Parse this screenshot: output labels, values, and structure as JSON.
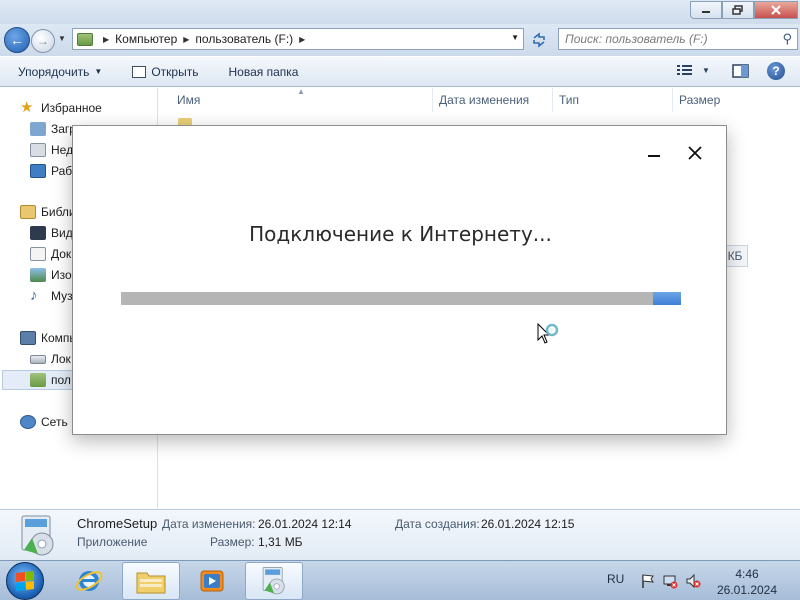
{
  "explorer": {
    "address": {
      "crumbs": [
        "Компьютер",
        "пользователь (F:)"
      ]
    },
    "search": {
      "placeholder": "Поиск: пользователь (F:)"
    },
    "toolbar": {
      "organize": "Упорядочить",
      "open": "Открыть",
      "new_folder": "Новая папка"
    },
    "nav": {
      "favorites": "Избранное",
      "fav_downloads": "Загр",
      "fav_recent": "Нед",
      "fav_desktop": "Раб",
      "libraries": "Библи",
      "lib_video": "Вид",
      "lib_docs": "Док",
      "lib_images": "Изо",
      "lib_music": "Муз",
      "computer": "Компь",
      "local_disk": "Лок",
      "user_drive": "пол",
      "network": "Сеть"
    },
    "columns": [
      "Имя",
      "Дата изменения",
      "Тип",
      "Размер"
    ],
    "peek_size_unit": "КБ",
    "details": {
      "name": "ChromeSetup",
      "type": "Приложение",
      "modified_label": "Дата изменения:",
      "modified_value": "26.01.2024 12:14",
      "size_label": "Размер:",
      "size_value": "1,31 МБ",
      "created_label": "Дата создания:",
      "created_value": "26.01.2024 12:15"
    }
  },
  "dialog": {
    "message": "Подключение к Интернету...",
    "progress_fraction": 0.05
  },
  "taskbar": {
    "language": "RU",
    "time": "4:46",
    "date": "26.01.2024"
  },
  "colors": {
    "progress_track": "#b5b5b5",
    "progress_fill": "#4a8ae0",
    "taskbar": "#b5c9e0"
  }
}
